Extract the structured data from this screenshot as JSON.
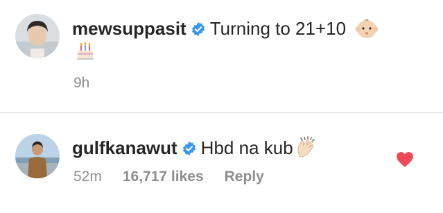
{
  "post": {
    "username": "mewsuppasit",
    "caption": "Turning to 21+10",
    "emoji_1": "baby-face-emoji",
    "emoji_2": "birthday-cake-emoji",
    "time": "9h"
  },
  "comment": {
    "username": "gulfkanawut",
    "text": "Hbd na kub",
    "emoji": "clapping-hands-emoji",
    "time": "52m",
    "likes": "16,717 likes",
    "reply": "Reply",
    "liked": true
  },
  "colors": {
    "verified": "#3897f0",
    "heart": "#ed4956",
    "meta": "#8e8e8e",
    "divider": "#dbdbdb"
  }
}
